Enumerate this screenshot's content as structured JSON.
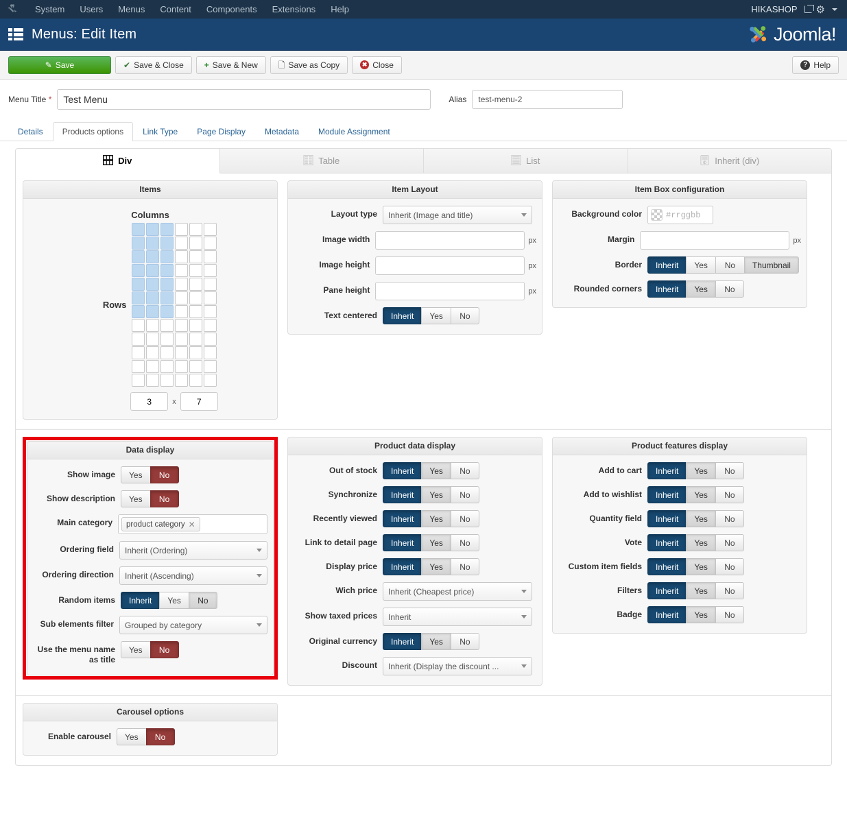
{
  "adminbar": {
    "logo_icon": "joomla-brand-icon",
    "menu": [
      "System",
      "Users",
      "Menus",
      "Content",
      "Components",
      "Extensions",
      "Help"
    ],
    "user_label": "HIKASHOP",
    "external_link_icon": "external-link-icon",
    "gear_icon": "gear-icon",
    "caret_icon": "chevron-down-icon"
  },
  "titlebar": {
    "icon": "menu-list-icon",
    "title": "Menus: Edit Item",
    "brand": "Joomla!",
    "brand_sup": "®"
  },
  "toolbar": {
    "save_label": "Save",
    "save_close_label": "Save & Close",
    "save_new_label": "Save & New",
    "save_copy_label": "Save as Copy",
    "close_label": "Close",
    "help_label": "Help",
    "save_icon": "pencil-square-icon",
    "save_close_icon": "check-icon",
    "save_new_icon": "plus-icon",
    "save_copy_icon": "copy-icon",
    "close_icon": "close-circle-icon",
    "help_icon": "question-circle-icon"
  },
  "form": {
    "menu_title_label": "Menu Title",
    "menu_title_required": "*",
    "menu_title_value": "Test Menu",
    "menu_title_placeholder": "",
    "alias_label": "Alias",
    "alias_value": "test-menu-2",
    "alias_placeholder": ""
  },
  "outer_tabs": [
    {
      "label": "Details",
      "active": false
    },
    {
      "label": "Products options",
      "active": true
    },
    {
      "label": "Link Type",
      "active": false
    },
    {
      "label": "Page Display",
      "active": false
    },
    {
      "label": "Metadata",
      "active": false
    },
    {
      "label": "Module Assignment",
      "active": false
    }
  ],
  "inner_tabs": [
    {
      "label": "Div",
      "icon": "grid-icon",
      "active": true
    },
    {
      "label": "Table",
      "icon": "table-icon",
      "active": false
    },
    {
      "label": "List",
      "icon": "list-icon",
      "active": false
    },
    {
      "label": "Inherit (div)",
      "icon": "inherit-icon",
      "active": false
    }
  ],
  "items_panel": {
    "title": "Items",
    "columns_label": "Columns",
    "rows_label": "Rows",
    "grid_cols": 6,
    "grid_rows": 12,
    "selected_cols": 3,
    "selected_rows": 7,
    "cols_value": "3",
    "rows_value": "7",
    "separator": "x"
  },
  "item_layout": {
    "title": "Item Layout",
    "fields": [
      {
        "label": "Layout type",
        "type": "select",
        "value": "Inherit (Image and title)"
      },
      {
        "label": "Image width",
        "type": "text",
        "value": "",
        "unit": "px"
      },
      {
        "label": "Image height",
        "type": "text",
        "value": "",
        "unit": "px"
      },
      {
        "label": "Pane height",
        "type": "text",
        "value": "",
        "unit": "px"
      },
      {
        "label": "Text centered",
        "type": "group",
        "options": [
          "Inherit",
          "Yes",
          "No"
        ],
        "selected": "Inherit",
        "selected_style": "blue"
      }
    ]
  },
  "item_box": {
    "title": "Item Box configuration",
    "bg_label": "Background color",
    "bg_placeholder": "#rrggbb",
    "bg_value": "",
    "bg_swatch_icon": "transparent-checker-icon",
    "margin_label": "Margin",
    "margin_value": "",
    "margin_unit": "px",
    "border": {
      "label": "Border",
      "options": [
        "Inherit",
        "Yes",
        "No",
        "Thumbnail"
      ],
      "selected": "Inherit",
      "selected_style": "blue",
      "extra_shaded": "Thumbnail"
    },
    "rounded": {
      "label": "Rounded corners",
      "options": [
        "Inherit",
        "Yes",
        "No"
      ],
      "selected": "Inherit",
      "selected_style": "blue"
    }
  },
  "data_display": {
    "title": "Data display",
    "highlighted": true,
    "highlight_color": "#e8000d",
    "fields": [
      {
        "label": "Show image",
        "type": "group",
        "options": [
          "Yes",
          "No"
        ],
        "selected": "No",
        "selected_style": "red"
      },
      {
        "label": "Show description",
        "type": "group",
        "options": [
          "Yes",
          "No"
        ],
        "selected": "No",
        "selected_style": "red"
      },
      {
        "label": "Main category",
        "type": "tags",
        "tags": [
          "product category"
        ],
        "tag_remove_icon": "close-x-icon"
      },
      {
        "label": "Ordering field",
        "type": "select",
        "value": "Inherit (Ordering)"
      },
      {
        "label": "Ordering direction",
        "type": "select",
        "value": "Inherit (Ascending)"
      },
      {
        "label": "Random items",
        "type": "group",
        "options": [
          "Inherit",
          "Yes",
          "No"
        ],
        "selected": "Inherit",
        "selected_style": "blue",
        "extra_shaded": "No"
      },
      {
        "label": "Sub elements filter",
        "type": "select",
        "value": "Grouped by category"
      },
      {
        "label": "Use the menu name as title",
        "type": "group",
        "options": [
          "Yes",
          "No"
        ],
        "selected": "No",
        "selected_style": "red"
      }
    ]
  },
  "product_data_display": {
    "title": "Product data display",
    "fields": [
      {
        "label": "Out of stock",
        "type": "group",
        "options": [
          "Inherit",
          "Yes",
          "No"
        ],
        "selected": "Inherit",
        "selected_style": "blue"
      },
      {
        "label": "Synchronize",
        "type": "group",
        "options": [
          "Inherit",
          "Yes",
          "No"
        ],
        "selected": "Inherit",
        "selected_style": "blue"
      },
      {
        "label": "Recently viewed",
        "type": "group",
        "options": [
          "Inherit",
          "Yes",
          "No"
        ],
        "selected": "Inherit",
        "selected_style": "blue"
      },
      {
        "label": "Link to detail page",
        "type": "group",
        "options": [
          "Inherit",
          "Yes",
          "No"
        ],
        "selected": "Inherit",
        "selected_style": "blue"
      },
      {
        "label": "Display price",
        "type": "group",
        "options": [
          "Inherit",
          "Yes",
          "No"
        ],
        "selected": "Inherit",
        "selected_style": "blue"
      },
      {
        "label": "Wich price",
        "type": "select",
        "value": "Inherit (Cheapest price)"
      },
      {
        "label": "Show taxed prices",
        "type": "select",
        "value": "Inherit"
      },
      {
        "label": "Original currency",
        "type": "group",
        "options": [
          "Inherit",
          "Yes",
          "No"
        ],
        "selected": "Inherit",
        "selected_style": "blue"
      },
      {
        "label": "Discount",
        "type": "select",
        "value": "Inherit (Display the discount ..."
      }
    ]
  },
  "product_features_display": {
    "title": "Product features display",
    "fields": [
      {
        "label": "Add to cart",
        "type": "group",
        "options": [
          "Inherit",
          "Yes",
          "No"
        ],
        "selected": "Inherit",
        "selected_style": "blue"
      },
      {
        "label": "Add to wishlist",
        "type": "group",
        "options": [
          "Inherit",
          "Yes",
          "No"
        ],
        "selected": "Inherit",
        "selected_style": "blue"
      },
      {
        "label": "Quantity field",
        "type": "group",
        "options": [
          "Inherit",
          "Yes",
          "No"
        ],
        "selected": "Inherit",
        "selected_style": "blue"
      },
      {
        "label": "Vote",
        "type": "group",
        "options": [
          "Inherit",
          "Yes",
          "No"
        ],
        "selected": "Inherit",
        "selected_style": "blue"
      },
      {
        "label": "Custom item fields",
        "type": "group",
        "options": [
          "Inherit",
          "Yes",
          "No"
        ],
        "selected": "Inherit",
        "selected_style": "blue"
      },
      {
        "label": "Filters",
        "type": "group",
        "options": [
          "Inherit",
          "Yes",
          "No"
        ],
        "selected": "Inherit",
        "selected_style": "blue"
      },
      {
        "label": "Badge",
        "type": "group",
        "options": [
          "Inherit",
          "Yes",
          "No"
        ],
        "selected": "Inherit",
        "selected_style": "blue"
      }
    ]
  },
  "carousel": {
    "title": "Carousel options",
    "fields": [
      {
        "label": "Enable carousel",
        "type": "group",
        "options": [
          "Yes",
          "No"
        ],
        "selected": "No",
        "selected_style": "red"
      }
    ]
  },
  "colors": {
    "adminbar_bg": "#1c3349",
    "titlebar_bg": "#1a4472",
    "save_green": "#3d9400",
    "active_blue": "#17486f",
    "active_red": "#953b39",
    "highlight_red": "#e8000d",
    "grid_selected": "#bcd7f0"
  }
}
